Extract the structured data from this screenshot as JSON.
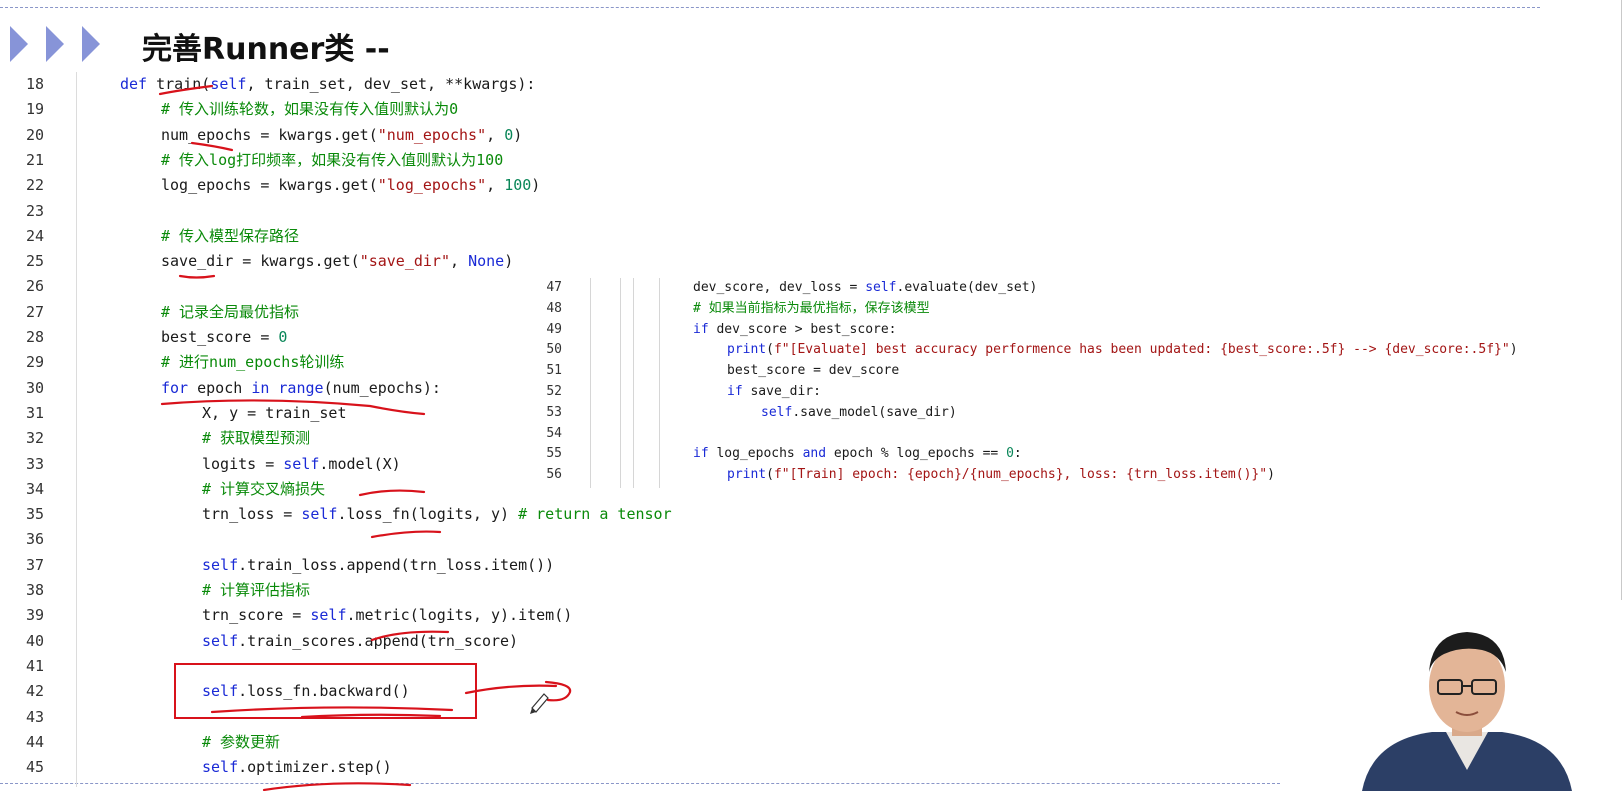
{
  "slide": {
    "title": "完善Runner类 --"
  },
  "main_code": {
    "lines": [
      {
        "n": "18",
        "indent": 0,
        "html_tokens": [
          [
            "kw",
            "def "
          ],
          [
            "",
            "train("
          ],
          [
            "kw",
            "self"
          ],
          [
            "",
            ", train_set, dev_set, **kwargs):"
          ]
        ]
      },
      {
        "n": "19",
        "indent": 1,
        "html_tokens": [
          [
            "cmt",
            "# 传入训练轮数，如果没有传入值则默认为0"
          ]
        ]
      },
      {
        "n": "20",
        "indent": 1,
        "html_tokens": [
          [
            "",
            "num_epochs = kwargs.get("
          ],
          [
            "str",
            "\"num_epochs\""
          ],
          [
            "",
            ", "
          ],
          [
            "num",
            "0"
          ],
          [
            "",
            ")"
          ]
        ]
      },
      {
        "n": "21",
        "indent": 1,
        "html_tokens": [
          [
            "cmt",
            "# 传入log打印频率，如果没有传入值则默认为100"
          ]
        ]
      },
      {
        "n": "22",
        "indent": 1,
        "html_tokens": [
          [
            "",
            "log_epochs = kwargs.get("
          ],
          [
            "str",
            "\"log_epochs\""
          ],
          [
            "",
            ", "
          ],
          [
            "num",
            "100"
          ],
          [
            "",
            ")"
          ]
        ]
      },
      {
        "n": "23",
        "indent": 0,
        "html_tokens": []
      },
      {
        "n": "24",
        "indent": 1,
        "html_tokens": [
          [
            "cmt",
            "# 传入模型保存路径"
          ]
        ]
      },
      {
        "n": "25",
        "indent": 1,
        "html_tokens": [
          [
            "",
            "save_dir = kwargs.get("
          ],
          [
            "str",
            "\"save_dir\""
          ],
          [
            "",
            ", "
          ],
          [
            "kw",
            "None"
          ],
          [
            "",
            ")"
          ]
        ]
      },
      {
        "n": "26",
        "indent": 0,
        "html_tokens": []
      },
      {
        "n": "27",
        "indent": 1,
        "html_tokens": [
          [
            "cmt",
            "# 记录全局最优指标"
          ]
        ]
      },
      {
        "n": "28",
        "indent": 1,
        "html_tokens": [
          [
            "",
            "best_score = "
          ],
          [
            "num",
            "0"
          ]
        ]
      },
      {
        "n": "29",
        "indent": 1,
        "html_tokens": [
          [
            "cmt",
            "# 进行num_epochs轮训练"
          ]
        ]
      },
      {
        "n": "30",
        "indent": 1,
        "html_tokens": [
          [
            "kw",
            "for"
          ],
          [
            "",
            " epoch "
          ],
          [
            "kw",
            "in"
          ],
          [
            "",
            " "
          ],
          [
            "kw",
            "range"
          ],
          [
            "",
            "(num_epochs):"
          ]
        ]
      },
      {
        "n": "31",
        "indent": 2,
        "html_tokens": [
          [
            "",
            "X, y = train_set"
          ]
        ]
      },
      {
        "n": "32",
        "indent": 2,
        "html_tokens": [
          [
            "cmt",
            "# 获取模型预测"
          ]
        ]
      },
      {
        "n": "33",
        "indent": 2,
        "html_tokens": [
          [
            "",
            "logits = "
          ],
          [
            "kw",
            "self"
          ],
          [
            "",
            ".model(X)"
          ]
        ]
      },
      {
        "n": "34",
        "indent": 2,
        "html_tokens": [
          [
            "cmt",
            "# 计算交叉熵损失"
          ]
        ]
      },
      {
        "n": "35",
        "indent": 2,
        "html_tokens": [
          [
            "",
            "trn_loss = "
          ],
          [
            "kw",
            "self"
          ],
          [
            "",
            ".loss_fn(logits, y) "
          ],
          [
            "cmt",
            "# return a tensor"
          ]
        ]
      },
      {
        "n": "36",
        "indent": 0,
        "html_tokens": []
      },
      {
        "n": "37",
        "indent": 2,
        "html_tokens": [
          [
            "kw",
            "self"
          ],
          [
            "",
            ".train_loss.append(trn_loss.item())"
          ]
        ]
      },
      {
        "n": "38",
        "indent": 2,
        "html_tokens": [
          [
            "cmt",
            "# 计算评估指标"
          ]
        ]
      },
      {
        "n": "39",
        "indent": 2,
        "html_tokens": [
          [
            "",
            "trn_score = "
          ],
          [
            "kw",
            "self"
          ],
          [
            "",
            ".metric(logits, y).item()"
          ]
        ]
      },
      {
        "n": "40",
        "indent": 2,
        "html_tokens": [
          [
            "kw",
            "self"
          ],
          [
            "",
            ".train_scores.append(trn_score)"
          ]
        ]
      },
      {
        "n": "41",
        "indent": 0,
        "html_tokens": []
      },
      {
        "n": "42",
        "indent": 2,
        "html_tokens": [
          [
            "kw",
            "self"
          ],
          [
            "",
            ".loss_fn.backward()"
          ]
        ]
      },
      {
        "n": "43",
        "indent": 0,
        "html_tokens": []
      },
      {
        "n": "44",
        "indent": 2,
        "html_tokens": [
          [
            "cmt",
            "# 参数更新"
          ]
        ]
      },
      {
        "n": "45",
        "indent": 2,
        "html_tokens": [
          [
            "kw",
            "self"
          ],
          [
            "",
            ".optimizer.step()"
          ]
        ]
      }
    ]
  },
  "inset_code": {
    "lines": [
      {
        "n": "47",
        "indent": 0,
        "html_tokens": [
          [
            "",
            "dev_score, dev_loss = "
          ],
          [
            "kw",
            "self"
          ],
          [
            "",
            ".evaluate(dev_set)"
          ]
        ]
      },
      {
        "n": "48",
        "indent": 0,
        "html_tokens": [
          [
            "cmt",
            "# 如果当前指标为最优指标，保存该模型"
          ]
        ]
      },
      {
        "n": "49",
        "indent": 0,
        "html_tokens": [
          [
            "kw",
            "if"
          ],
          [
            "",
            " dev_score > best_score:"
          ]
        ]
      },
      {
        "n": "50",
        "indent": 1,
        "html_tokens": [
          [
            "kw",
            "print"
          ],
          [
            "",
            "("
          ],
          [
            "str",
            "f\"[Evaluate] best accuracy performence has been updated: {best_score:.5f} --> {dev_score:.5f}\""
          ],
          [
            "",
            ")"
          ]
        ]
      },
      {
        "n": "51",
        "indent": 1,
        "html_tokens": [
          [
            "",
            "best_score = dev_score"
          ]
        ]
      },
      {
        "n": "52",
        "indent": 1,
        "html_tokens": [
          [
            "kw",
            "if"
          ],
          [
            "",
            " save_dir:"
          ]
        ]
      },
      {
        "n": "53",
        "indent": 2,
        "html_tokens": [
          [
            "kw",
            "self"
          ],
          [
            "",
            ".save_model(save_dir)"
          ]
        ]
      },
      {
        "n": "54",
        "indent": 0,
        "html_tokens": []
      },
      {
        "n": "55",
        "indent": 0,
        "html_tokens": [
          [
            "kw",
            "if"
          ],
          [
            "",
            " log_epochs "
          ],
          [
            "kw",
            "and"
          ],
          [
            "",
            " epoch % log_epochs == "
          ],
          [
            "num",
            "0"
          ],
          [
            "",
            ":"
          ]
        ]
      },
      {
        "n": "56",
        "indent": 1,
        "html_tokens": [
          [
            "kw",
            "print"
          ],
          [
            "",
            "("
          ],
          [
            "str",
            "f\"[Train] epoch: {epoch}/{num_epochs}, loss: {trn_loss.item()}\""
          ],
          [
            "",
            ")"
          ]
        ]
      }
    ]
  },
  "colors": {
    "keyword": "#1a2ad6",
    "string": "#a31515",
    "number": "#098658",
    "comment": "#0a8a0a",
    "annotation": "#d8121b",
    "chevron": "#8794d8"
  }
}
